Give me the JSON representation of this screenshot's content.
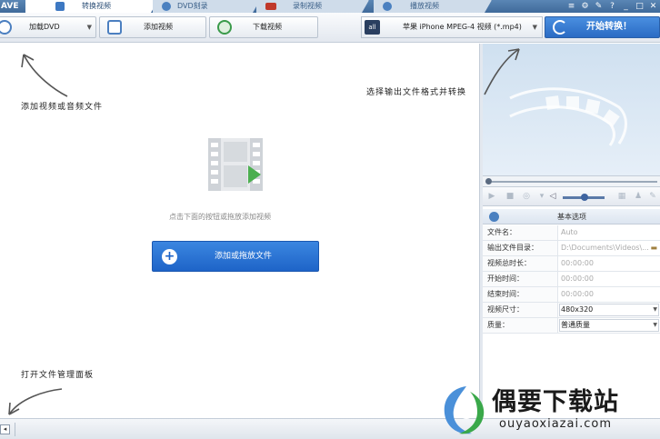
{
  "app": {
    "logo_text": "AVE"
  },
  "tabs": [
    {
      "label": "转换视频",
      "active": true
    },
    {
      "label": "DVD刻录",
      "active": false
    },
    {
      "label": "录制视频",
      "active": false
    },
    {
      "label": "播放视频",
      "active": false
    }
  ],
  "window_buttons": [
    "≡",
    "⚙",
    "✎",
    "?",
    "_",
    "□",
    "✕"
  ],
  "toolbar": {
    "load_dvd_label": "加载DVD",
    "add_video_label": "添加视频",
    "download_video_label": "下载视频",
    "format_badge": "all",
    "format_selected": "苹果 iPhone MPEG-4 视频 (*.mp4)",
    "start_label": "开始转换！"
  },
  "main": {
    "hint_add": "添加视频或音频文件",
    "hint_format": "选择输出文件格式并转换",
    "hint_manager": "打开文件管理面板",
    "drop_text": "点击下面的按钮或拖放添加视频",
    "add_button_label": "添加或拖放文件"
  },
  "properties": {
    "header": "基本选项",
    "rows": [
      {
        "key": "文件名：",
        "value": "Auto",
        "dark": false,
        "dropdown": false
      },
      {
        "key": "输出文件目录：",
        "value": "D:\\Documents\\Videos\\...",
        "dark": false,
        "dropdown": false
      },
      {
        "key": "视频总时长：",
        "value": "00:00:00",
        "dark": false,
        "dropdown": false
      },
      {
        "key": "开始时间：",
        "value": "00:00:00",
        "dark": false,
        "dropdown": false
      },
      {
        "key": "结束时间：",
        "value": "00:00:00",
        "dark": false,
        "dropdown": false
      },
      {
        "key": "视频尺寸：",
        "value": "480x320",
        "dark": true,
        "dropdown": true
      },
      {
        "key": "质量：",
        "value": "普通质量",
        "dark": true,
        "dropdown": true
      }
    ]
  },
  "watermark": {
    "title": "偶要下载站",
    "url": "ouyaoxiazai.com"
  }
}
